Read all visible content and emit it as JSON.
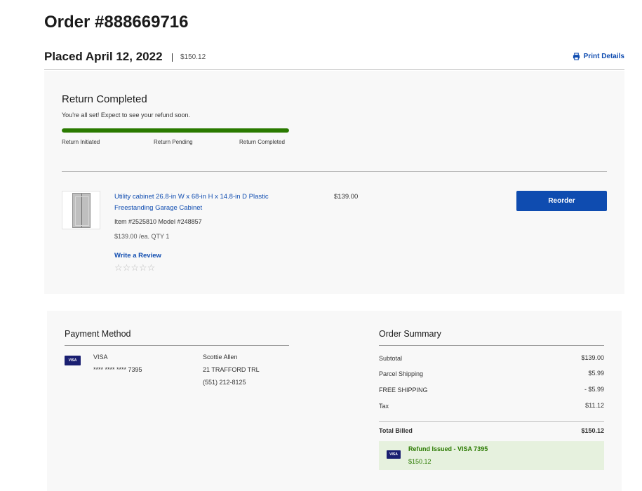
{
  "order": {
    "title": "Order #888669716",
    "placed": "Placed April 12, 2022",
    "total": "$150.12",
    "print_label": "Print Details"
  },
  "return_status": {
    "title": "Return Completed",
    "message": "You're all set! Expect to see your refund soon.",
    "progress_fraction": 1.0,
    "progress_color": "#2a7a00",
    "steps": [
      "Return Initiated",
      "Return Pending",
      "Return Completed"
    ]
  },
  "product": {
    "name": "Utility cabinet 26.8-in W x 68-in H x 14.8-in D Plastic Freestanding Garage Cabinet",
    "meta": "Item #2525810 Model #248857",
    "unit_qty": "$139.00 /ea. QTY 1",
    "price": "$139.00",
    "review_label": "Write a Review",
    "rating_stars": 0,
    "reorder_label": "Reorder"
  },
  "payment": {
    "title": "Payment Method",
    "card_brand_badge": "VISA",
    "card_name": "VISA",
    "card_number": "**** **** **** 7395",
    "name": "Scottie Allen",
    "address": "21 TRAFFORD TRL",
    "phone": "(551) 212-8125"
  },
  "summary": {
    "title": "Order Summary",
    "rows": [
      {
        "label": "Subtotal",
        "value": "$139.00"
      },
      {
        "label": "Parcel Shipping",
        "value": "$5.99"
      },
      {
        "label": "FREE SHIPPING",
        "value": "- $5.99"
      },
      {
        "label": "Tax",
        "value": "$11.12"
      }
    ],
    "total_label": "Total Billed",
    "total_value": "$150.12",
    "refund_badge": "VISA",
    "refund_label": "Refund Issued - VISA 7395",
    "refund_amount": "$150.12"
  },
  "colors": {
    "accent_blue": "#0f4cb0",
    "success_green": "#2a7a00",
    "visa_navy": "#1a1f71"
  }
}
